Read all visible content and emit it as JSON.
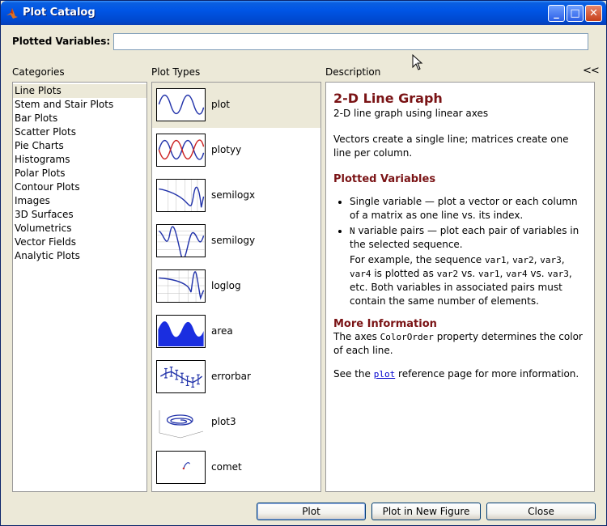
{
  "window": {
    "title": "Plot Catalog",
    "min_glyph": "_",
    "max_glyph": "□",
    "close_glyph": "✕"
  },
  "plotted_variables": {
    "label": "Plotted Variables:",
    "value": ""
  },
  "headers": {
    "categories": "Categories",
    "plot_types": "Plot Types",
    "description": "Description",
    "collapse": "<<"
  },
  "categories": [
    "Line Plots",
    "Stem and Stair Plots",
    "Bar Plots",
    "Scatter Plots",
    "Pie Charts",
    "Histograms",
    "Polar Plots",
    "Contour Plots",
    "Images",
    "3D Surfaces",
    "Volumetrics",
    "Vector Fields",
    "Analytic Plots"
  ],
  "selected_category": "Line Plots",
  "plot_types": [
    "plot",
    "plotyy",
    "semilogx",
    "semilogy",
    "loglog",
    "area",
    "errorbar",
    "plot3",
    "comet"
  ],
  "selected_plot_type": "plot",
  "description": {
    "title": "2-D Line Graph",
    "subtitle": "2-D line graph using linear axes",
    "para1": "Vectors create a single line; matrices create one line per column.",
    "plotted_vars_heading": "Plotted Variables",
    "bullet1": "Single variable — plot a vector or each column of a matrix as one line vs. its index.",
    "bullet2_mono": "N",
    "bullet2_text": " variable pairs — plot each pair of variables in the selected sequence.",
    "ex_1": "For example, the sequence ",
    "ex_var1": "var1",
    "ex_c1": ", ",
    "ex_var2": "var2",
    "ex_c2": ", ",
    "ex_var3": "var3",
    "ex_c3": ", ",
    "ex_var4": "var4",
    "ex_2": " is plotted as ",
    "ex_var2b": "var2",
    "ex_vs1": " vs. ",
    "ex_var1b": "var1",
    "ex_c4": ", ",
    "ex_var4b": "var4",
    "ex_vs2": " vs. ",
    "ex_var3b": "var3",
    "ex_3": ", etc. Both variables in associated pairs must contain the same number of elements.",
    "more_info_heading": "More Information",
    "more_1": "The axes ",
    "more_mono": "ColorOrder",
    "more_2": " property determines the color of each line.",
    "see_1": "See the ",
    "see_link": "plot",
    "see_2": " reference page for more information."
  },
  "buttons": {
    "plot": "Plot",
    "plot_new_figure": "Plot in New Figure",
    "close": "Close"
  }
}
